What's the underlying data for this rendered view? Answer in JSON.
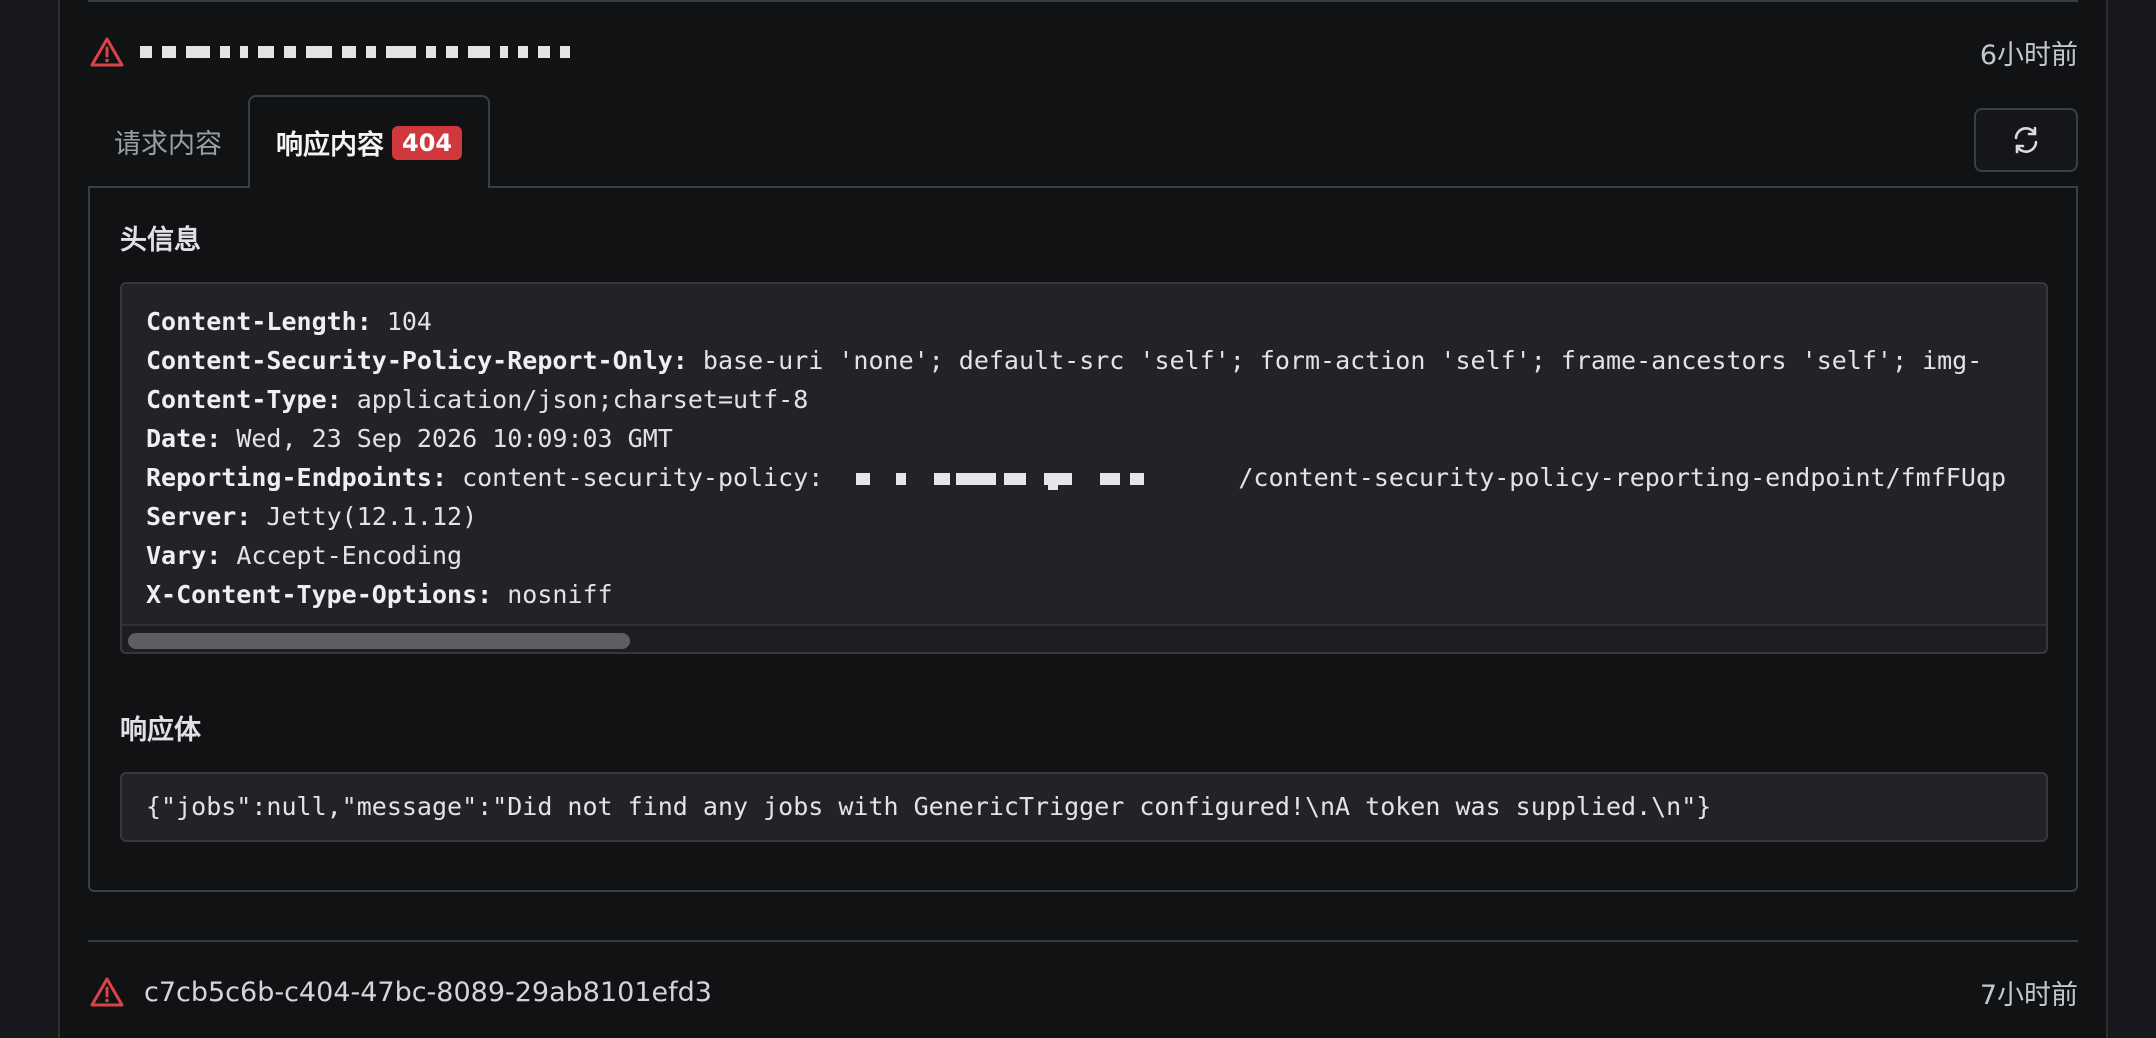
{
  "deliveries": [
    {
      "id": "",
      "time": "6小时前",
      "status": "warning"
    },
    {
      "id": "c7cb5c6b-c404-47bc-8089-29ab8101efd3",
      "time": "7小时前",
      "status": "warning"
    }
  ],
  "tabs": [
    {
      "label": "请求内容",
      "active": false
    },
    {
      "label": "响应内容",
      "active": true,
      "badge": "404"
    }
  ],
  "headers_section": {
    "title": "头信息",
    "lines": [
      {
        "key": "Content-Length:",
        "value": " 104"
      },
      {
        "key": "Content-Security-Policy-Report-Only:",
        "value": " base-uri 'none'; default-src 'self'; form-action 'self'; frame-ancestors 'self'; img-"
      },
      {
        "key": "Content-Type:",
        "value": " application/json;charset=utf-8"
      },
      {
        "key": "Date:",
        "value": " Wed, 23 Sep 2026 10:09:03 GMT"
      },
      {
        "key": "Reporting-Endpoints:",
        "value_prefix": " content-security-policy: ",
        "value_suffix": "/content-security-policy-reporting-endpoint/fmfFUqp"
      },
      {
        "key": "Server:",
        "value": " Jetty(12.1.12)"
      },
      {
        "key": "Vary:",
        "value": " Accept-Encoding"
      },
      {
        "key": "X-Content-Type-Options:",
        "value": " nosniff"
      }
    ]
  },
  "body_section": {
    "title": "响应体",
    "content": "{\"jobs\":null,\"message\":\"Did not find any jobs with GenericTrigger configured!\\nA token was supplied.\\n\"}"
  },
  "icons": {
    "warning": "warning-triangle-icon",
    "refresh": "refresh-icon"
  },
  "colors": {
    "warning": "#d9434a",
    "badge": "#d1383d",
    "background": "#111214"
  }
}
